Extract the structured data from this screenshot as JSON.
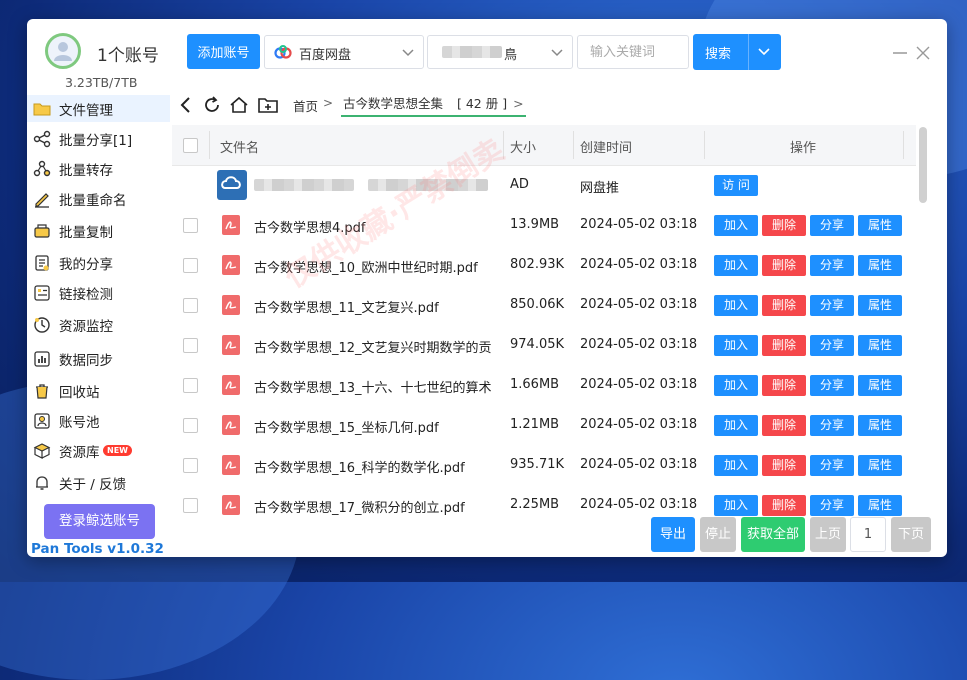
{
  "header": {
    "account_name": "1个账号",
    "quota": "3.23TB/7TB",
    "add_account": "添加账号",
    "pan_select": "百度网盘",
    "account_select_tail": "鳥",
    "search_placeholder": "输入关键词",
    "search_button": "搜索"
  },
  "sidebar": {
    "items": [
      {
        "label": "文件管理",
        "icon": "folder-icon"
      },
      {
        "label": "批量分享[1]",
        "icon": "share-icon"
      },
      {
        "label": "批量转存",
        "icon": "transfer-icon"
      },
      {
        "label": "批量重命名",
        "icon": "rename-icon"
      },
      {
        "label": "批量复制",
        "icon": "copy-icon"
      },
      {
        "label": "我的分享",
        "icon": "my-share-icon"
      },
      {
        "label": "链接检测",
        "icon": "link-check-icon"
      },
      {
        "label": "资源监控",
        "icon": "monitor-icon"
      },
      {
        "label": "数据同步",
        "icon": "sync-icon"
      },
      {
        "label": "回收站",
        "icon": "trash-icon"
      },
      {
        "label": "账号池",
        "icon": "account-pool-icon"
      },
      {
        "label": "资源库",
        "icon": "resource-icon"
      },
      {
        "label": "关于 / 反馈",
        "icon": "bell-icon"
      }
    ],
    "new_badge": "NEW",
    "login_button": "登录鲸选账号",
    "version": "Pan Tools v1.0.32"
  },
  "breadcrumb": {
    "home": "首页",
    "current": "古今数学思想全集",
    "count_label": "[ 42 册 ]"
  },
  "table": {
    "columns": {
      "name": "文件名",
      "size": "大小",
      "time": "创建时间",
      "actions": "操作"
    },
    "ad_row": {
      "size": "AD",
      "time": "网盘推",
      "action": "访 问"
    },
    "rows": [
      {
        "name": "古今数学思想4.pdf",
        "size": "13.9MB",
        "time": "2024-05-02 03:18"
      },
      {
        "name": "古今数学思想_10_欧洲中世纪时期.pdf",
        "size": "802.93K",
        "time": "2024-05-02 03:18"
      },
      {
        "name": "古今数学思想_11_文艺复兴.pdf",
        "size": "850.06K",
        "time": "2024-05-02 03:18"
      },
      {
        "name": "古今数学思想_12_文艺复兴时期数学的贡",
        "size": "974.05K",
        "time": "2024-05-02 03:18"
      },
      {
        "name": "古今数学思想_13_十六、十七世纪的算术",
        "size": "1.66MB",
        "time": "2024-05-02 03:18"
      },
      {
        "name": "古今数学思想_15_坐标几何.pdf",
        "size": "1.21MB",
        "time": "2024-05-02 03:18"
      },
      {
        "name": "古今数学思想_16_科学的数学化.pdf",
        "size": "935.71K",
        "time": "2024-05-02 03:18"
      },
      {
        "name": "古今数学思想_17_微积分的创立.pdf",
        "size": "2.25MB",
        "time": "2024-05-02 03:18"
      }
    ],
    "action_labels": {
      "add": "加入",
      "delete": "删除",
      "share": "分享",
      "props": "属性"
    }
  },
  "footer": {
    "export": "导出",
    "stop": "停止",
    "get_all": "获取全部",
    "prev": "上页",
    "page": "1",
    "next": "下页"
  },
  "colors": {
    "primary": "#1e90ff",
    "danger": "#f5474b",
    "success": "#2ecc71",
    "disabled": "#c8c8c8",
    "login": "#7b72f2"
  }
}
